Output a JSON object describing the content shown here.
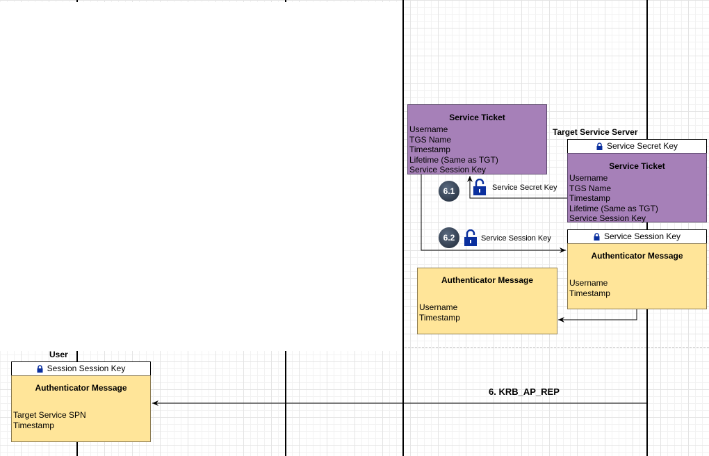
{
  "colors": {
    "service_ticket": "#a680b8",
    "authenticator": "#ffe599",
    "lock": "#0a2f9e"
  },
  "target_server": {
    "label": "Target Service Server"
  },
  "user": {
    "label": "User"
  },
  "service_ticket_decrypted": {
    "title": "Service Ticket",
    "lines": [
      "Username",
      "TGS Name",
      "Timestamp",
      "Lifetime (Same as TGT)",
      "Service Session Key"
    ]
  },
  "service_ticket_encrypted": {
    "key": "Service Secret Key",
    "title": "Service Ticket",
    "lines": [
      "Username",
      "TGS Name",
      "Timestamp",
      "Lifetime (Same as TGT)",
      "Service Session Key"
    ]
  },
  "auth_encrypted": {
    "key": "Service Session Key",
    "title": "Authenticator Message",
    "lines": [
      "Username",
      "Timestamp"
    ]
  },
  "auth_decrypted": {
    "title": "Authenticator Message",
    "lines": [
      "Username",
      "Timestamp"
    ]
  },
  "step_6_1": {
    "badge": "6.1",
    "key": "Service Secret Key",
    "icon": "unlock-icon"
  },
  "step_6_2": {
    "badge": "6.2",
    "key": "Service Session Key",
    "icon": "unlock-icon"
  },
  "user_auth": {
    "key": "Session Session Key",
    "title": "Authenticator Message",
    "lines": [
      "Target Service SPN",
      "Timestamp"
    ]
  },
  "message": {
    "label": "6. KRB_AP_REP"
  }
}
